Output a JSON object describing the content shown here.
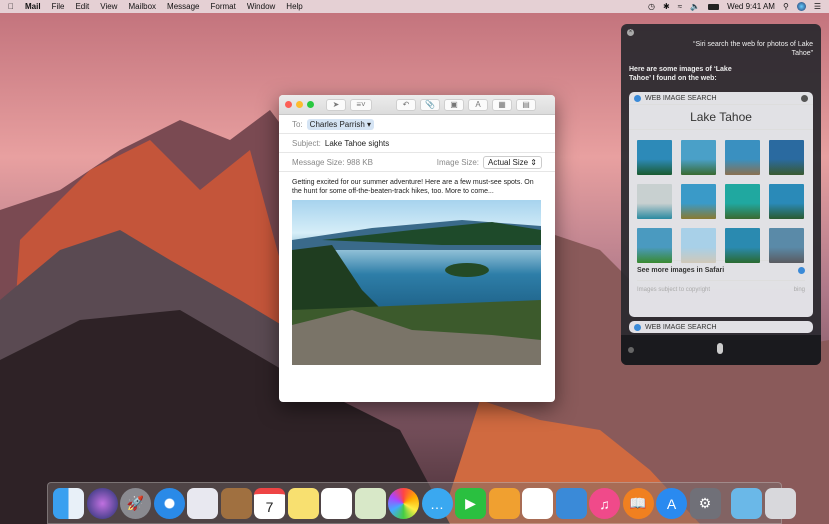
{
  "menubar": {
    "app": "Mail",
    "items": [
      "File",
      "Edit",
      "View",
      "Mailbox",
      "Message",
      "Format",
      "Window",
      "Help"
    ],
    "clock": "Wed 9:41 AM"
  },
  "mail": {
    "to_label": "To:",
    "to": "Charles Parrish",
    "subject_label": "Subject:",
    "subject": "Lake Tahoe sights",
    "size_label": "Message Size:",
    "size": "988 KB",
    "image_size_label": "Image Size:",
    "image_size": "Actual Size",
    "body": "Getting excited for our summer adventure! Here are a few must-see spots. On the hunt for some off-the-beaten-track hikes, too. More to come..."
  },
  "siri": {
    "query": "“Siri search the web for photos of Lake Tahoe”",
    "response": "Here are some images of ‘Lake Tahoe’ I found on the web:",
    "card_header": "WEB IMAGE SEARCH",
    "card_title": "Lake Tahoe",
    "see_more": "See more images in Safari",
    "copyright": "Images subject to copyright",
    "bing": "bing",
    "card2_header": "WEB IMAGE SEARCH"
  },
  "dock": [
    "finder",
    "siri",
    "launchpad",
    "safari",
    "mail",
    "contacts",
    "calendar",
    "notes",
    "reminders",
    "maps",
    "photos",
    "messages",
    "facetime",
    "pages",
    "numbers",
    "keynote",
    "itunes",
    "ibooks",
    "app-store",
    "system-preferences",
    "downloads",
    "trash"
  ],
  "calendar_day": "7"
}
